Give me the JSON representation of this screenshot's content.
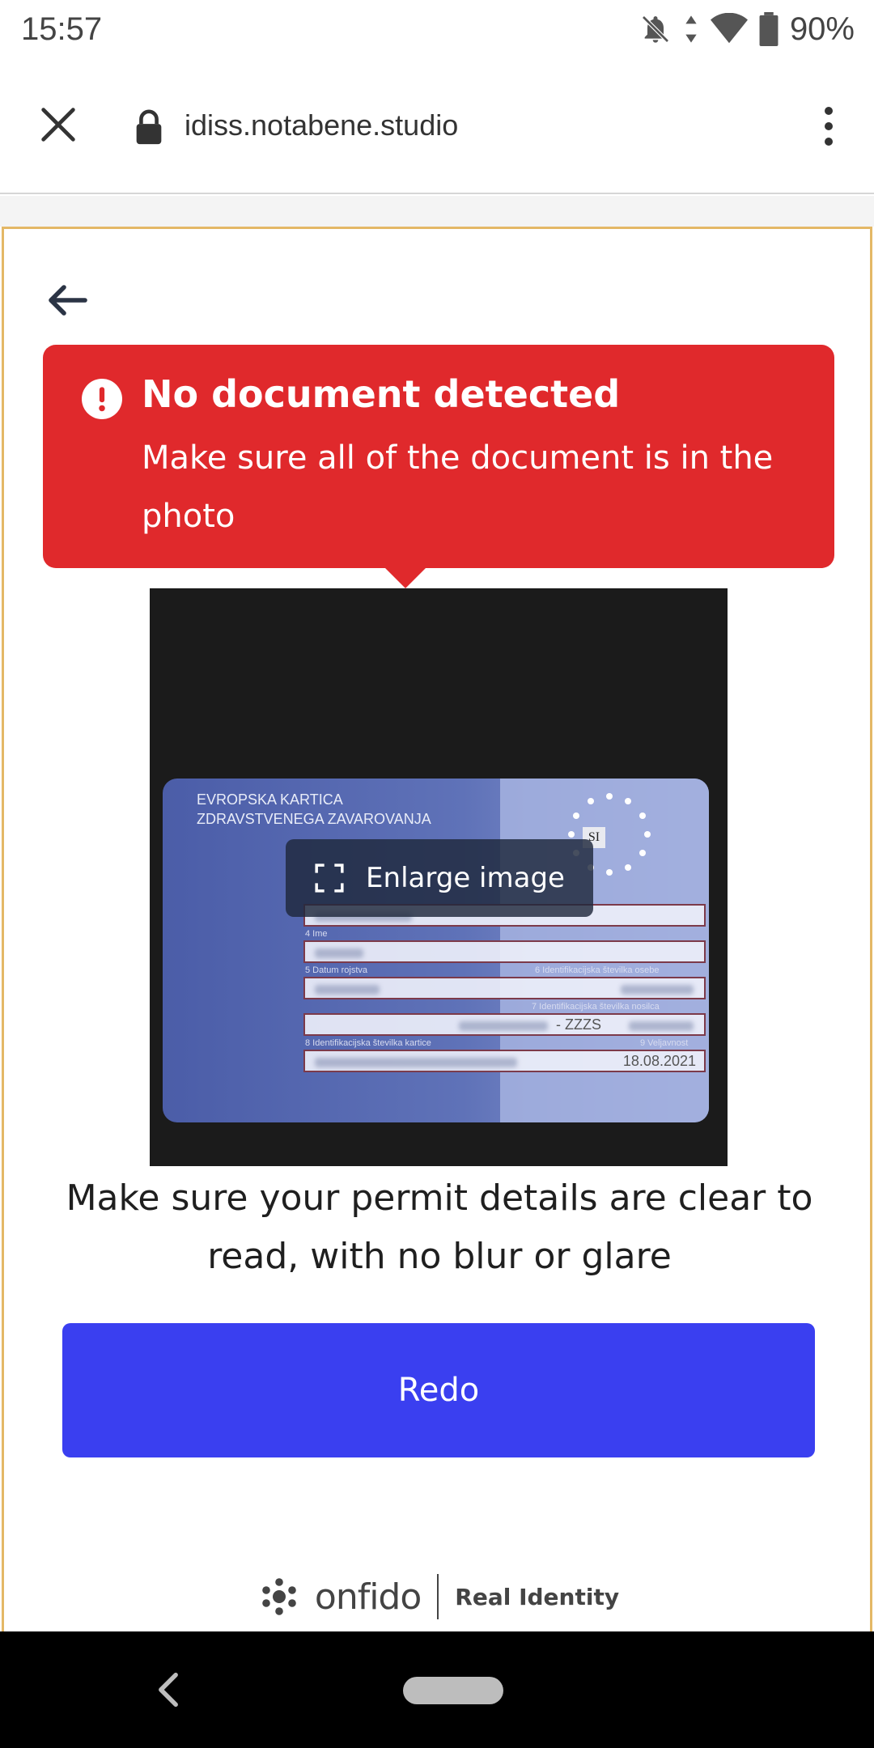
{
  "status_bar": {
    "time": "15:57",
    "battery": "90%",
    "icons": [
      "notifications-off-icon",
      "data-arrows-icon",
      "wifi-icon",
      "battery-icon"
    ]
  },
  "browser": {
    "url": "idiss.notabene.studio",
    "close_icon": "close-icon",
    "lock_icon": "lock-icon",
    "menu_icon": "more-vert-icon"
  },
  "alert": {
    "title": "No document detected",
    "message": "Make sure all of the document is in the photo",
    "icon": "exclamation-icon",
    "color": "#e0292c"
  },
  "photo": {
    "card_header": [
      "EVROPSKA KARTICA",
      "ZDRAVSTVENEGA ZAVAROVANJA"
    ],
    "country_code": "SI",
    "labels": {
      "name": "4 Ime",
      "birth": "5 Datum rojstva",
      "person_id": "6 Identifikacijska številka osebe",
      "holder_id": "7 Identifikacijska številka nosilca",
      "card_id": "8 Identifikacijska številka kartice",
      "validity": "9 Veljavnost"
    },
    "holder_code": "- ZZZS",
    "expiry": "18.08.2021",
    "enlarge_label": "Enlarge image"
  },
  "instruction": "Make sure your permit details are clear to read, with no blur or glare",
  "redo_label": "Redo",
  "footer": {
    "brand": "onfido",
    "tagline": "Real Identity"
  },
  "colors": {
    "accent": "#3a3ff0",
    "frame_border": "#e4b866"
  }
}
